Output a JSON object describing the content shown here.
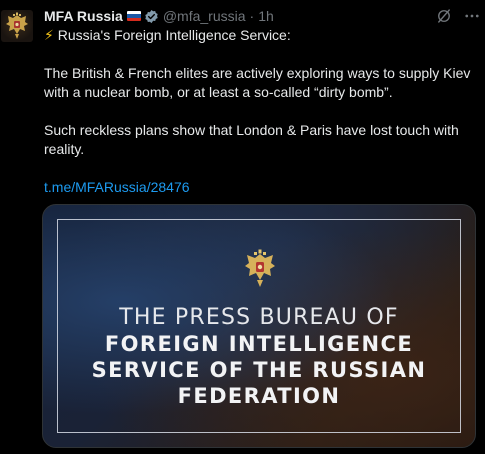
{
  "author": {
    "display_name": "MFA Russia",
    "handle": "@mfa_russia",
    "separator": "·",
    "time": "1h",
    "avatar_icon": "russian-coat-of-arms-icon",
    "flag_icon": "russia-flag-icon",
    "verified_icon": "verified-badge-icon"
  },
  "actions": {
    "grok_icon": "grok-icon",
    "more_icon": "more-options-icon"
  },
  "tweet": {
    "lead_emoji": "⚡",
    "line1": "Russia's Foreign Intelligence Service:",
    "para2": "The British & French elites are actively exploring ways to supply Kiev with a nuclear bomb, or at least a so-called “dirty bomb”.",
    "para3": "Such reckless plans show that London & Paris have lost touch with reality.",
    "link": "t.me/MFARussia/28476"
  },
  "media": {
    "emblem_icon": "russian-coat-of-arms-icon",
    "line1": "THE PRESS BUREAU OF",
    "line2": "FOREIGN INTELLIGENCE",
    "line3": "SERVICE OF THE RUSSIAN",
    "line4": "FEDERATION"
  },
  "colors": {
    "background": "#000000",
    "text": "#e7e9ea",
    "secondary": "#71767b",
    "link": "#1d9bf0",
    "verified": "#829aab"
  }
}
